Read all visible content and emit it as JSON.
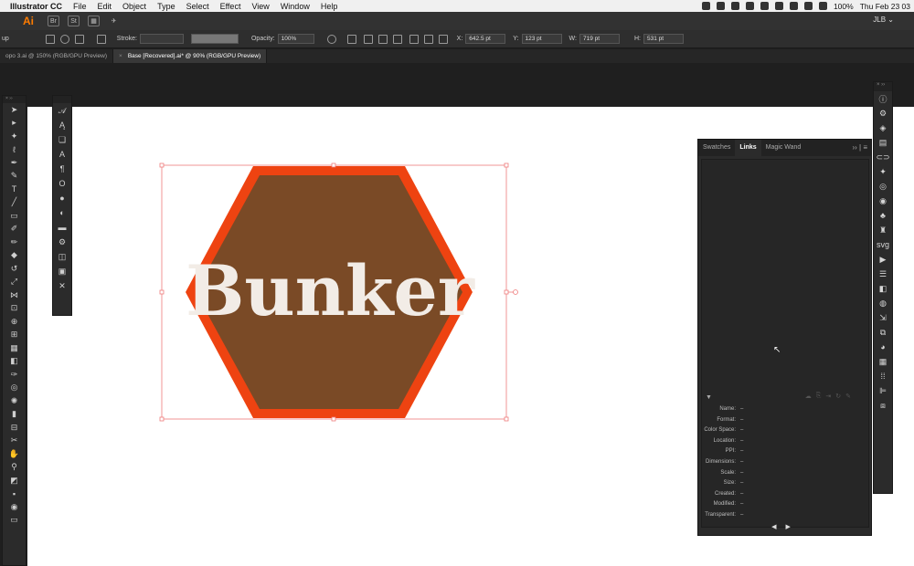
{
  "menubar": {
    "app_name": "Illustrator CC",
    "items": [
      "File",
      "Edit",
      "Object",
      "Type",
      "Select",
      "Effect",
      "View",
      "Window",
      "Help"
    ],
    "battery": "100%",
    "clock": "Thu Feb 23  03"
  },
  "appbar": {
    "logo": "Ai",
    "br": "Br",
    "st": "St",
    "user": "JLB ⌄"
  },
  "control_bar": {
    "group_label": "up",
    "stroke_label": "Stroke:",
    "opacity_label": "Opacity:",
    "opacity_value": "100%",
    "x_label": "X:",
    "x_value": "642.5 pt",
    "y_label": "Y:",
    "y_value": "123 pt",
    "w_label": "W:",
    "w_value": "719 pt",
    "h_label": "H:",
    "h_value": "531 pt"
  },
  "tabs": [
    {
      "label": "opo 3.ai @ 150% (RGB/GPU Preview)"
    },
    {
      "label": "Base [Recovered].ai* @ 90% (RGB/GPU Preview)"
    }
  ],
  "artwork": {
    "text": "Bunker",
    "hex_fill": "#7a4a26",
    "hex_stroke": "#ee4311",
    "text_color": "#f2ece6"
  },
  "links_panel": {
    "tabs": [
      "Swatches",
      "Links",
      "Magic Wand"
    ],
    "active_tab": "Links",
    "info": [
      {
        "key": "Name:",
        "value": "–"
      },
      {
        "key": "Format:",
        "value": "–"
      },
      {
        "key": "Color Space:",
        "value": "–"
      },
      {
        "key": "Location:",
        "value": "–"
      },
      {
        "key": "PPI:",
        "value": "–"
      },
      {
        "key": "Dimensions:",
        "value": "–"
      },
      {
        "key": "Scale:",
        "value": "–"
      },
      {
        "key": "Size:",
        "value": "–"
      },
      {
        "key": "Created:",
        "value": "–"
      },
      {
        "key": "Modified:",
        "value": "–"
      },
      {
        "key": "Transparent:",
        "value": "–"
      }
    ]
  },
  "colors": {
    "selection": "#ef7b7b",
    "artboard": "#ffffff",
    "pasteboard": "#1f1f1f"
  }
}
